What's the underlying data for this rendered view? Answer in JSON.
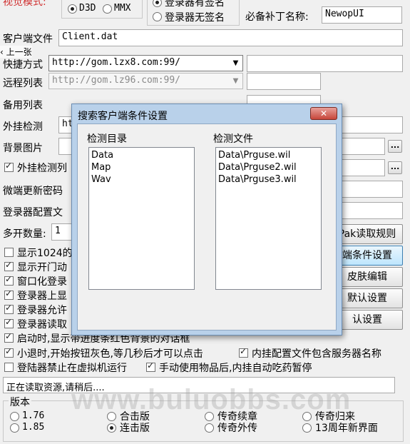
{
  "top": {
    "partial_label": "视觉模式:",
    "render_options": [
      "D3D",
      "MMX"
    ],
    "render_selected": 0,
    "login_sign_options": [
      "登录器有签名",
      "登录器无签名"
    ],
    "login_sign_selected": 0,
    "patch_label": "必备补丁名称:",
    "patch_value": "NewopUI"
  },
  "back_overlay": "‹ 上一张",
  "rows": {
    "client_file_label": "客户端文件",
    "client_file_value": "Client.dat",
    "quick_label": "快捷方式",
    "quick_value": "http://gom.lzx8.com:99/",
    "remote_label": "远程列表",
    "remote_value": "http://gom.lz96.com:99/",
    "backup_label": "备用列表",
    "plugin_detect_label": "外挂检测",
    "plugin_detect_value": "ht",
    "bg_label": "背景图片",
    "plugin_list_label": "外挂检测列",
    "micro_pwd_label": "微端更新密码",
    "login_cfg_label": "登录器配置文",
    "multi_label": "多开数量:",
    "multi_value": "1",
    "browse": "..."
  },
  "checks": [
    {
      "label": "显示1024的",
      "checked": false
    },
    {
      "label": "显示开门动",
      "checked": true
    },
    {
      "label": "窗口化登录",
      "checked": true
    },
    {
      "label": "登录器上显",
      "checked": true
    },
    {
      "label": "登录器允许",
      "checked": true
    },
    {
      "label": "登录器读取",
      "checked": true
    },
    {
      "label": "启动时,显示带进度条红色背景的对话框",
      "checked": true
    }
  ],
  "checks_row2": {
    "exit_gray": {
      "label": "小退时,开始按钮灰色,等几秒后才可以点击",
      "checked": true
    },
    "include_server": {
      "label": "内挂配置文件包含服务器名称",
      "checked": true
    },
    "no_vm": {
      "label": "登陆器禁止在虚拟机运行",
      "checked": false
    },
    "auto_potion": {
      "label": "手动使用物品后,内挂自动吃药暂停",
      "checked": true
    }
  },
  "right_buttons": {
    "pak_read": "Pak读取规则",
    "search_cond": "端条件设置",
    "skin_edit": "皮肤编辑",
    "default1": "默认设置",
    "default2": "认设置"
  },
  "status": "正在读取资源,请稍后....",
  "version": {
    "title": "版本",
    "options": [
      {
        "label": "1.76",
        "selected": false
      },
      {
        "label": "1.85",
        "selected": false
      },
      {
        "label": "合击版",
        "selected": false
      },
      {
        "label": "连击版",
        "selected": true
      },
      {
        "label": "传奇续章",
        "selected": false
      },
      {
        "label": "传奇外传",
        "selected": false
      },
      {
        "label": "传奇归来",
        "selected": false
      },
      {
        "label": "13周年新界面",
        "selected": false
      }
    ]
  },
  "dialog": {
    "title": "搜索客户端条件设置",
    "close": "✕",
    "dir_header": "检测目录",
    "file_header": "检测文件",
    "dirs": [
      "Data",
      "Map",
      "Wav"
    ],
    "files": [
      "Data\\Prguse.wil",
      "Data\\Prguse2.wil",
      "Data\\Prguse3.wil"
    ]
  },
  "watermark": "www.buluobbs.com"
}
